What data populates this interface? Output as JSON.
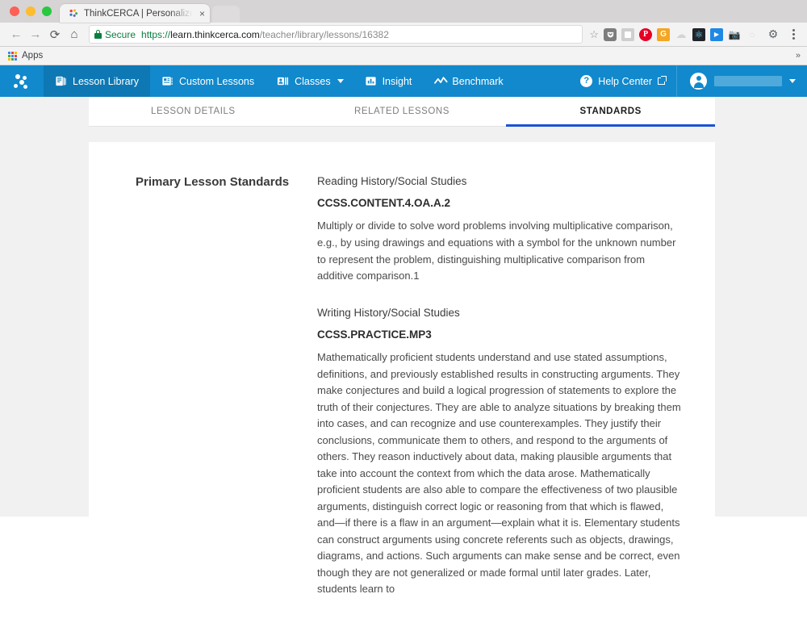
{
  "browser": {
    "tab": {
      "title": "ThinkCERCA | Personalized Lit",
      "close_label": "×",
      "favicon_name": "thinkcerca-favicon"
    },
    "toolbar": {
      "back_label": "←",
      "forward_label": "→",
      "reload_label": "⟳",
      "home_label": "⌂",
      "security_label": "Secure",
      "url_scheme": "https://",
      "url_host": "learn.thinkcerca.com",
      "url_path": "/teacher/library/lessons/16382",
      "star_label": "☆",
      "extensions": [
        {
          "name": "pocket-extension-icon",
          "glyph": "▼",
          "bg": "#7d7d7d",
          "fg": "#ffffff"
        },
        {
          "name": "note-extension-icon",
          "glyph": "⬜",
          "bg": "#c9c9c9",
          "fg": "#ffffff"
        },
        {
          "name": "pinterest-extension-icon",
          "glyph": "P",
          "bg": "#e60023",
          "fg": "#ffffff"
        },
        {
          "name": "grammarly-extension-icon",
          "glyph": "G",
          "bg": "#f5a623",
          "fg": "#ffffff"
        },
        {
          "name": "cloud-extension-icon",
          "glyph": "☁",
          "bg": "#d8d8d8",
          "fg": "#ffffff"
        },
        {
          "name": "react-devtools-extension-icon",
          "glyph": "⚛",
          "bg": "#20232a",
          "fg": "#61dafb"
        },
        {
          "name": "video-extension-icon",
          "glyph": "▶",
          "bg": "#1e88e5",
          "fg": "#ffffff"
        },
        {
          "name": "screenshot-extension-icon",
          "glyph": "◉",
          "bg": "#9e9e9e",
          "fg": "#ffffff"
        },
        {
          "name": "disabled-extension-icon",
          "glyph": "○",
          "bg": "#e4e4e4",
          "fg": "#c0c0c0"
        }
      ],
      "settings_label": "⚙",
      "menu_label": "kebab-menu"
    },
    "bookmarks": {
      "apps_label": "Apps",
      "overflow_label": "»"
    }
  },
  "app_nav": {
    "brand_name": "ThinkCERCA",
    "items": [
      {
        "label": "Lesson Library",
        "icon": "book-icon",
        "selected": true
      },
      {
        "label": "Custom Lessons",
        "icon": "custom-lesson-icon",
        "selected": false
      },
      {
        "label": "Classes",
        "icon": "classes-icon",
        "selected": false,
        "has_caret": true
      },
      {
        "label": "Insight",
        "icon": "bar-chart-icon",
        "selected": false
      },
      {
        "label": "Benchmark",
        "icon": "trend-line-icon",
        "selected": false
      }
    ],
    "help": {
      "label": "Help Center",
      "icon": "question-mark-icon",
      "external_icon": "external-link-icon"
    },
    "user": {
      "avatar_icon": "user-avatar-icon",
      "name": "",
      "caret_icon": "chevron-down-icon"
    }
  },
  "content_tabs": [
    {
      "label": "LESSON DETAILS",
      "active": false
    },
    {
      "label": "RELATED LESSONS",
      "active": false
    },
    {
      "label": "STANDARDS",
      "active": true
    }
  ],
  "standards": {
    "section_title": "Primary Lesson Standards",
    "blocks": [
      {
        "subject": "Reading History/Social Studies",
        "code": "CCSS.CONTENT.4.OA.A.2",
        "description": "Multiply or divide to solve word problems involving multiplicative comparison, e.g., by using drawings and equations with a symbol for the unknown number to represent the problem, distinguishing multiplicative comparison from additive comparison.1"
      },
      {
        "subject": "Writing History/Social Studies",
        "code": "CCSS.PRACTICE.MP3",
        "description": "Mathematically proficient students understand and use stated assumptions, definitions, and previously established results in constructing arguments. They make conjectures and build a logical progression of statements to explore the truth of their conjectures. They are able to analyze situations by breaking them into cases, and can recognize and use counterexamples. They justify their conclusions, communicate them to others, and respond to the arguments of others. They reason inductively about data, making plausible arguments that take into account the context from which the data arose. Mathematically proficient students are also able to compare the effectiveness of two plausible arguments, distinguish correct logic or reasoning from that which is flawed, and—if there is a flaw in an argument—explain what it is. Elementary students can construct arguments using concrete referents such as objects, drawings, diagrams, and actions. Such arguments can make sense and be correct, even though they are not generalized or made formal until later grades. Later, students learn to"
      }
    ]
  },
  "colors": {
    "brand_blue": "#1189cc",
    "nav_selected": "#0e78b4",
    "tab_underline": "#1a52d6",
    "secure_green": "#0b7e3e",
    "page_bg": "#f1f1f1"
  }
}
